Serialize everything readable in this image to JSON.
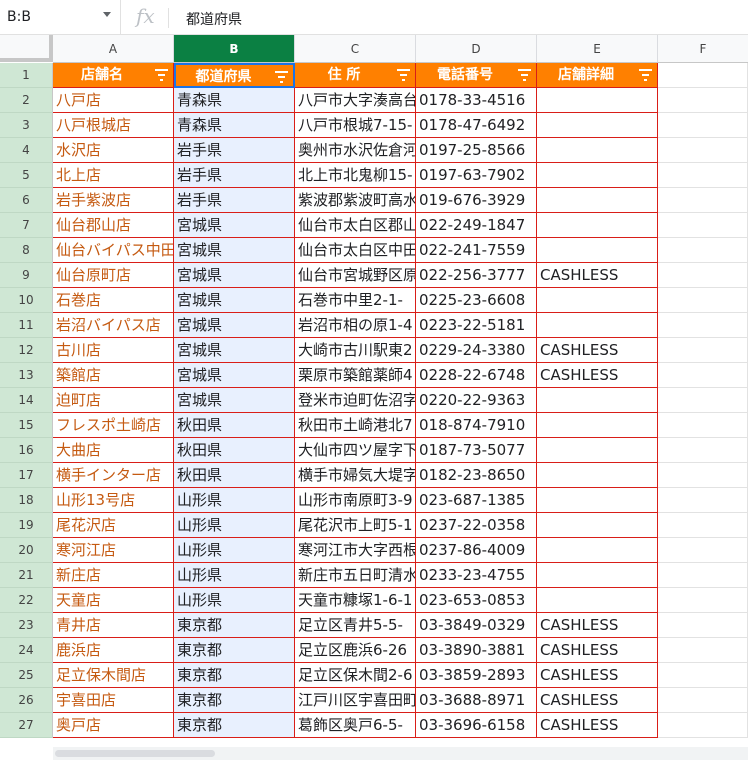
{
  "formula_bar": {
    "name_box": "B:B",
    "fx": "fx",
    "value": "都道府県"
  },
  "columns": [
    "A",
    "B",
    "C",
    "D",
    "E",
    "F"
  ],
  "header_row": {
    "row_number": "1",
    "cells": [
      "店舗名",
      "都道府県",
      "住 所",
      "電話番号",
      "店舗詳細"
    ]
  },
  "rows": [
    {
      "n": "2",
      "name": "八戸店",
      "pref": "青森県",
      "addr": "八戸市大字湊高台",
      "tel": "0178-33-4516",
      "detail": ""
    },
    {
      "n": "3",
      "name": "八戸根城店",
      "pref": "青森県",
      "addr": "八戸市根城7-15-",
      "tel": "0178-47-6492",
      "detail": ""
    },
    {
      "n": "4",
      "name": "水沢店",
      "pref": "岩手県",
      "addr": "奥州市水沢佐倉河",
      "tel": "0197-25-8566",
      "detail": ""
    },
    {
      "n": "5",
      "name": "北上店",
      "pref": "岩手県",
      "addr": "北上市北鬼柳15-",
      "tel": "0197-63-7902",
      "detail": ""
    },
    {
      "n": "6",
      "name": "岩手紫波店",
      "pref": "岩手県",
      "addr": "紫波郡紫波町高水",
      "tel": "019-676-3929",
      "detail": ""
    },
    {
      "n": "7",
      "name": "仙台郡山店",
      "pref": "宮城県",
      "addr": "仙台市太白区郡山",
      "tel": "022-249-1847",
      "detail": ""
    },
    {
      "n": "8",
      "name": "仙台バイパス中田",
      "pref": "宮城県",
      "addr": "仙台市太白区中田",
      "tel": "022-241-7559",
      "detail": ""
    },
    {
      "n": "9",
      "name": "仙台原町店",
      "pref": "宮城県",
      "addr": "仙台市宮城野区原",
      "tel": "022-256-3777",
      "detail": "CASHLESS"
    },
    {
      "n": "10",
      "name": "石巻店",
      "pref": "宮城県",
      "addr": "石巻市中里2-1-",
      "tel": "0225-23-6608",
      "detail": ""
    },
    {
      "n": "11",
      "name": "岩沼バイパス店",
      "pref": "宮城県",
      "addr": "岩沼市相の原1-4",
      "tel": "0223-22-5181",
      "detail": ""
    },
    {
      "n": "12",
      "name": "古川店",
      "pref": "宮城県",
      "addr": "大崎市古川駅東2",
      "tel": "0229-24-3380",
      "detail": "CASHLESS"
    },
    {
      "n": "13",
      "name": "築館店",
      "pref": "宮城県",
      "addr": "栗原市築館薬師4",
      "tel": "0228-22-6748",
      "detail": "CASHLESS"
    },
    {
      "n": "14",
      "name": "迫町店",
      "pref": "宮城県",
      "addr": "登米市迫町佐沼字",
      "tel": "0220-22-9363",
      "detail": ""
    },
    {
      "n": "15",
      "name": "フレスポ土崎店",
      "pref": "秋田県",
      "addr": "秋田市土崎港北7",
      "tel": "018-874-7910",
      "detail": ""
    },
    {
      "n": "16",
      "name": "大曲店",
      "pref": "秋田県",
      "addr": "大仙市四ツ屋字下",
      "tel": "0187-73-5077",
      "detail": ""
    },
    {
      "n": "17",
      "name": "横手インター店",
      "pref": "秋田県",
      "addr": "横手市婦気大堤字",
      "tel": "0182-23-8650",
      "detail": ""
    },
    {
      "n": "18",
      "name": "山形13号店",
      "pref": "山形県",
      "addr": "山形市南原町3-9",
      "tel": "023-687-1385",
      "detail": ""
    },
    {
      "n": "19",
      "name": "尾花沢店",
      "pref": "山形県",
      "addr": "尾花沢市上町5-1",
      "tel": "0237-22-0358",
      "detail": ""
    },
    {
      "n": "20",
      "name": "寒河江店",
      "pref": "山形県",
      "addr": "寒河江市大字西根",
      "tel": "0237-86-4009",
      "detail": ""
    },
    {
      "n": "21",
      "name": "新庄店",
      "pref": "山形県",
      "addr": "新庄市五日町清水",
      "tel": "0233-23-4755",
      "detail": ""
    },
    {
      "n": "22",
      "name": "天童店",
      "pref": "山形県",
      "addr": "天童市糠塚1-6-1",
      "tel": "023-653-0853",
      "detail": ""
    },
    {
      "n": "23",
      "name": "青井店",
      "pref": "東京都",
      "addr": "足立区青井5-5-",
      "tel": "03-3849-0329",
      "detail": "CASHLESS"
    },
    {
      "n": "24",
      "name": "鹿浜店",
      "pref": "東京都",
      "addr": "足立区鹿浜6-26",
      "tel": "03-3890-3881",
      "detail": "CASHLESS"
    },
    {
      "n": "25",
      "name": "足立保木間店",
      "pref": "東京都",
      "addr": "足立区保木間2-6",
      "tel": "03-3859-2893",
      "detail": "CASHLESS"
    },
    {
      "n": "26",
      "name": "宇喜田店",
      "pref": "東京都",
      "addr": "江戸川区宇喜田町",
      "tel": "03-3688-8971",
      "detail": "CASHLESS"
    },
    {
      "n": "27",
      "name": "奥戸店",
      "pref": "東京都",
      "addr": "葛飾区奥戸6-5-",
      "tel": "03-3696-6158",
      "detail": "CASHLESS"
    }
  ],
  "colors": {
    "header_bg": "#ff8000",
    "border": "#d91e18",
    "name_text": "#c55a11",
    "selected_col": "#0b8043",
    "selected_fill": "#e8f0fe"
  }
}
